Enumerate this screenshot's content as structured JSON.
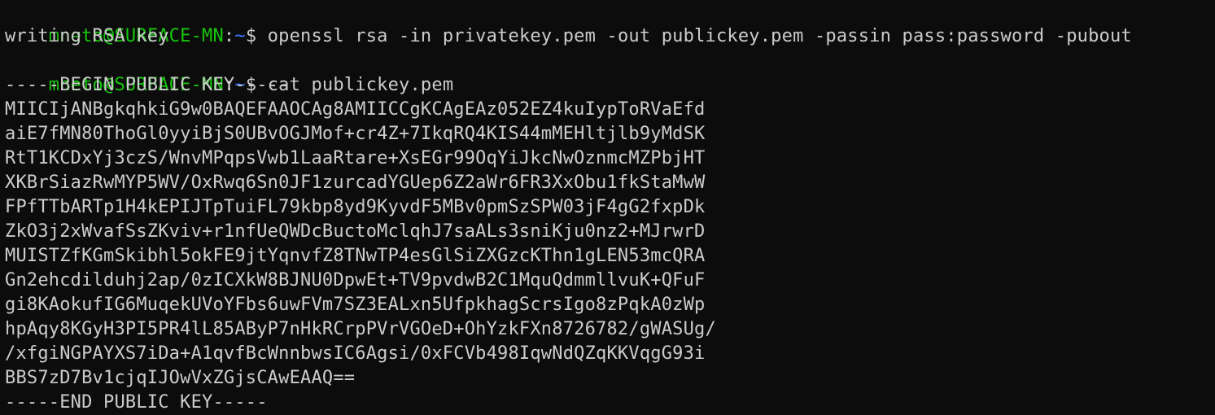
{
  "terminal": {
    "colors": {
      "background": "#0c0c0c",
      "text": "#cccccc",
      "user": "#16c60c",
      "path": "#3b78ff"
    },
    "lines": [
      {
        "user": "mneto@SURFACE-MN",
        "sep": ":",
        "path": "~",
        "symbol": "$ ",
        "command": "openssl rsa -in privatekey.pem -out publickey.pem -passin pass:password -pubout"
      },
      {
        "text": "writing RSA key"
      },
      {
        "user": "mneto@SURFACE-MN",
        "sep": ":",
        "path": "~",
        "symbol": "$ ",
        "command": "cat publickey.pem"
      },
      {
        "text": "-----BEGIN PUBLIC KEY-----"
      },
      {
        "text": "MIICIjANBgkqhkiG9w0BAQEFAAOCAg8AMIICCgKCAgEAz052EZ4kuIypToRVaEfd"
      },
      {
        "text": "aiE7fMN80ThoGl0yyiBjS0UBvOGJMof+cr4Z+7IkqRQ4KIS44mMEHltjlb9yMdSK"
      },
      {
        "text": "RtT1KCDxYj3czS/WnvMPqpsVwb1LaaRtare+XsEGr99OqYiJkcNwOznmcMZPbjHT"
      },
      {
        "text": "XKBrSiazRwMYP5WV/OxRwq6Sn0JF1zurcadYGUep6Z2aWr6FR3XxObu1fkStaMwW"
      },
      {
        "text": "FPfTTbARTp1H4kEPIJTpTuiFL79kbp8yd9KyvdF5MBv0pmSzSPW03jF4gG2fxpDk"
      },
      {
        "text": "ZkO3j2xWvafSsZKviv+r1nfUeQWDcBuctoMclqhJ7saALs3sniKju0nz2+MJrwrD"
      },
      {
        "text": "MUISTZfKGmSkibhl5okFE9jtYqnvfZ8TNwTP4esGlSiZXGzcKThn1gLEN53mcQRA"
      },
      {
        "text": "Gn2ehcdilduhj2ap/0zICXkW8BJNU0DpwEt+TV9pvdwB2C1MquQdmmllvuK+QFuF"
      },
      {
        "text": "gi8KAokufIG6MuqekUVoYFbs6uwFVm7SZ3EALxn5UfpkhagScrsIgo8zPqkA0zWp"
      },
      {
        "text": "hpAqy8KGyH3PI5PR4lL85AByP7nHkRCrpPVrVGOeD+OhYzkFXn8726782/gWASUg/"
      },
      {
        "text": "/xfgiNGPAYXS7iDa+A1qvfBcWnnbwsIC6Agsi/0xFCVb498IqwNdQZqKKVqgG93i"
      },
      {
        "text": "BBS7zD7Bv1cjqIJOwVxZGjsCAwEAAQ=="
      },
      {
        "text": "-----END PUBLIC KEY-----"
      }
    ]
  }
}
